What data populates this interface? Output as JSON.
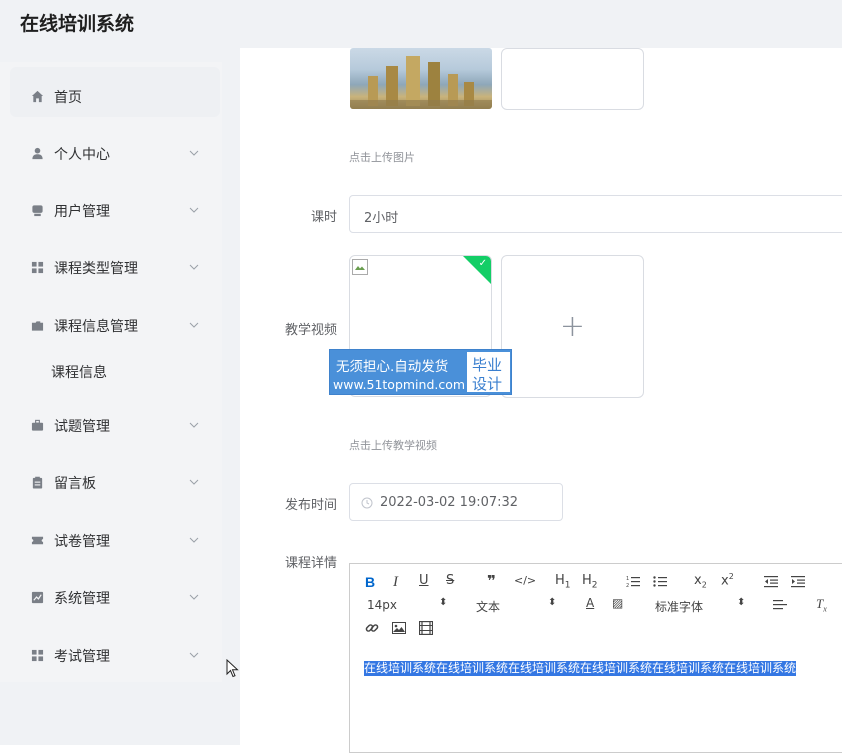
{
  "app": {
    "title": "在线培训系统"
  },
  "sidebar": {
    "items": [
      {
        "label": "首页",
        "icon": "home-icon"
      },
      {
        "label": "个人中心",
        "icon": "user-icon"
      },
      {
        "label": "用户管理",
        "icon": "users-icon"
      },
      {
        "label": "课程类型管理",
        "icon": "grid-icon"
      },
      {
        "label": "课程信息管理",
        "icon": "folder-icon"
      },
      {
        "label": "试题管理",
        "icon": "briefcase-icon"
      },
      {
        "label": "留言板",
        "icon": "clipboard-icon"
      },
      {
        "label": "试卷管理",
        "icon": "ticket-icon"
      },
      {
        "label": "系统管理",
        "icon": "chart-icon"
      },
      {
        "label": "考试管理",
        "icon": "grid-icon"
      }
    ],
    "submenu": {
      "label": "课程信息"
    }
  },
  "form": {
    "image_tip": "点击上传图片",
    "hours_label": "课时",
    "hours_value": "2小时",
    "video_label": "教学视频",
    "video_tip": "点击上传教学视频",
    "publish_label": "发布时间",
    "publish_value": "2022-03-02 19:07:32",
    "detail_label": "课程详情"
  },
  "watermark": {
    "line1": "无须担心.自动发货",
    "line2": "www.51topmind.com",
    "right1": "毕业",
    "right2": "设计"
  },
  "editor": {
    "font_size": "14px",
    "header_select": "文本",
    "font_select": "标准字体",
    "content": "在线培训系统在线培训系统在线培训系统在线培训系统在线培训系统在线培训系统"
  }
}
